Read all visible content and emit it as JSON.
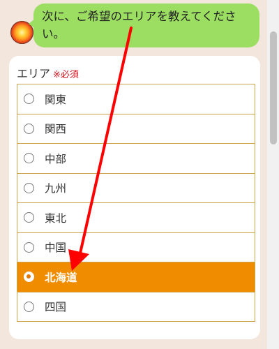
{
  "chat": {
    "message": "次に、ご希望のエリアを教えてください。"
  },
  "form": {
    "field_label": "エリア",
    "required_mark": "※必須",
    "selected_index": 6,
    "options": [
      {
        "label": "関東"
      },
      {
        "label": "関西"
      },
      {
        "label": "中部"
      },
      {
        "label": "九州"
      },
      {
        "label": "東北"
      },
      {
        "label": "中国"
      },
      {
        "label": "北海道"
      },
      {
        "label": "四国"
      }
    ]
  },
  "colors": {
    "bubble": "#9bde62",
    "selected_option": "#f08c00",
    "option_border": "#c9a24a",
    "required": "#d4141f",
    "annotation_arrow": "#ff0000"
  },
  "icons": {
    "avatar": "sun-avatar-icon",
    "radio": "radio-icon"
  }
}
